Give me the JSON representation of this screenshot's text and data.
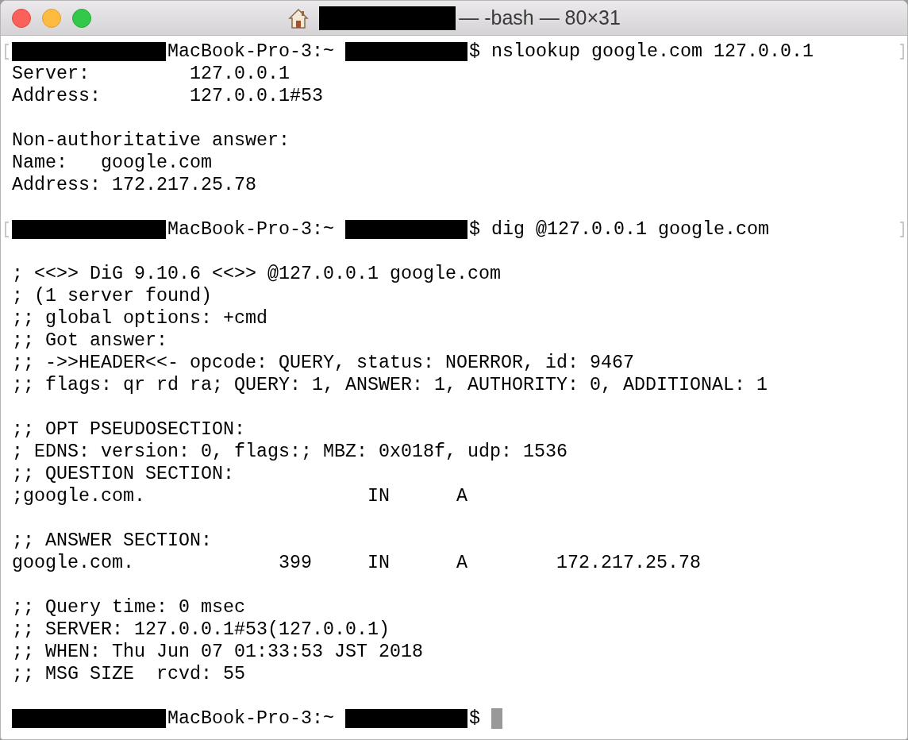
{
  "window": {
    "title": "— -bash — 80×31",
    "title_redacted": true
  },
  "lines": [
    {
      "kind": "prompt",
      "host": "MacBook-Pro-3:~",
      "command": "$ nslookup google.com 127.0.0.1",
      "marked": true,
      "cursor": false
    },
    {
      "kind": "output",
      "text": "Server:         127.0.0.1"
    },
    {
      "kind": "output",
      "text": "Address:        127.0.0.1#53"
    },
    {
      "kind": "blank"
    },
    {
      "kind": "output",
      "text": "Non-authoritative answer:"
    },
    {
      "kind": "output",
      "text": "Name:   google.com"
    },
    {
      "kind": "output",
      "text": "Address: 172.217.25.78"
    },
    {
      "kind": "blank"
    },
    {
      "kind": "prompt",
      "host": "MacBook-Pro-3:~",
      "command": "$ dig @127.0.0.1 google.com",
      "marked": true,
      "cursor": false
    },
    {
      "kind": "blank"
    },
    {
      "kind": "output",
      "text": "; <<>> DiG 9.10.6 <<>> @127.0.0.1 google.com"
    },
    {
      "kind": "output",
      "text": "; (1 server found)"
    },
    {
      "kind": "output",
      "text": ";; global options: +cmd"
    },
    {
      "kind": "output",
      "text": ";; Got answer:"
    },
    {
      "kind": "output",
      "text": ";; ->>HEADER<<- opcode: QUERY, status: NOERROR, id: 9467"
    },
    {
      "kind": "output",
      "text": ";; flags: qr rd ra; QUERY: 1, ANSWER: 1, AUTHORITY: 0, ADDITIONAL: 1"
    },
    {
      "kind": "blank"
    },
    {
      "kind": "output",
      "text": ";; OPT PSEUDOSECTION:"
    },
    {
      "kind": "output",
      "text": "; EDNS: version: 0, flags:; MBZ: 0x018f, udp: 1536"
    },
    {
      "kind": "output",
      "text": ";; QUESTION SECTION:"
    },
    {
      "kind": "output",
      "text": ";google.com.                    IN      A"
    },
    {
      "kind": "blank"
    },
    {
      "kind": "output",
      "text": ";; ANSWER SECTION:"
    },
    {
      "kind": "output",
      "text": "google.com.             399     IN      A        172.217.25.78"
    },
    {
      "kind": "blank"
    },
    {
      "kind": "output",
      "text": ";; Query time: 0 msec"
    },
    {
      "kind": "output",
      "text": ";; SERVER: 127.0.0.1#53(127.0.0.1)"
    },
    {
      "kind": "output",
      "text": ";; WHEN: Thu Jun 07 01:33:53 JST 2018"
    },
    {
      "kind": "output",
      "text": ";; MSG SIZE  rcvd: 55"
    },
    {
      "kind": "blank"
    },
    {
      "kind": "prompt",
      "host": "MacBook-Pro-3:~",
      "command": "$",
      "marked": false,
      "cursor": true
    }
  ]
}
